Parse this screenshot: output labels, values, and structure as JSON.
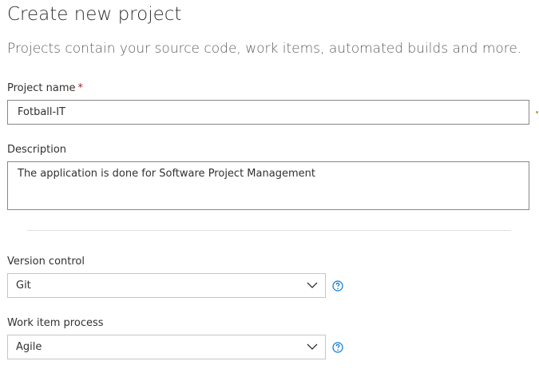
{
  "header": {
    "title": "Create new project",
    "subtitle": "Projects contain your source code, work items, automated builds and more."
  },
  "form": {
    "project_name": {
      "label": "Project name",
      "required_marker": "*",
      "value": "Fotball-IT"
    },
    "description": {
      "label": "Description",
      "value": "The application is done for Software Project Management"
    },
    "version_control": {
      "label": "Version control",
      "value": "Git",
      "help_icon": "help-circle-icon"
    },
    "work_item_process": {
      "label": "Work item process",
      "value": "Agile",
      "help_icon": "help-circle-icon"
    }
  },
  "colors": {
    "accent": "#0078d4",
    "required": "#a4262c",
    "border": "#8a8886"
  }
}
